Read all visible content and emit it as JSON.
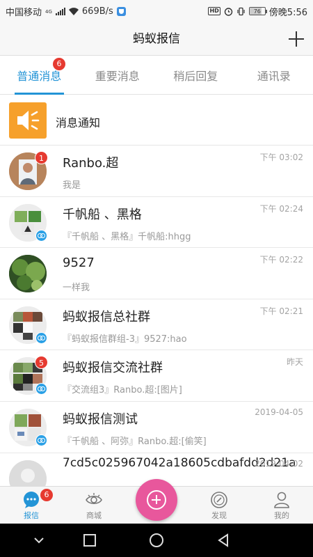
{
  "status_bar": {
    "carrier": "中国移动",
    "network": "4G",
    "speed": "669B/s",
    "battery": "76",
    "time": "傍晚5:56"
  },
  "header": {
    "title": "蚂蚁报信"
  },
  "tabs": [
    {
      "label": "普通消息",
      "active": true,
      "badge": "6"
    },
    {
      "label": "重要消息"
    },
    {
      "label": "稍后回复"
    },
    {
      "label": "通讯录"
    }
  ],
  "notice": {
    "label": "消息通知"
  },
  "conversations": [
    {
      "name": "Ranbo.超",
      "preview": "我是",
      "time": "下午 03:02",
      "unread": "1"
    },
    {
      "name": "千帆船 、黑格",
      "preview": "『千帆船 、黑格』千帆船:hhgg",
      "time": "下午 02:24"
    },
    {
      "name": "9527",
      "preview": "一样我",
      "time": "下午 02:22"
    },
    {
      "name": "蚂蚁报信总社群",
      "preview": "『蚂蚁报信群组-3』9527:hao",
      "time": "下午 02:21"
    },
    {
      "name": "蚂蚁报信交流社群",
      "preview": "『交流组3』Ranbo.超:[图片]",
      "time": "昨天",
      "unread": "5"
    },
    {
      "name": "蚂蚁报信测试",
      "preview": "『千帆船 、阿弥』Ranbo.超:[偷笑]",
      "time": "2019-04-05"
    },
    {
      "name": "7cd5c025967042a18605cdbafdd2d21a",
      "preview": "",
      "time": "2019-04-02"
    }
  ],
  "bottom_nav": [
    {
      "label": "报信",
      "badge": "6",
      "active": true,
      "icon": "chat-bubble-icon"
    },
    {
      "label": "商城",
      "icon": "eye-icon"
    },
    {
      "label": "",
      "icon": "add-circle-icon"
    },
    {
      "label": "发现",
      "icon": "compass-icon"
    },
    {
      "label": "我的",
      "icon": "person-icon"
    }
  ],
  "colors": {
    "accent": "#2394d6",
    "badge": "#e63a30",
    "notice_orange": "#f6a02b",
    "fab_pink": "#e8579c"
  }
}
